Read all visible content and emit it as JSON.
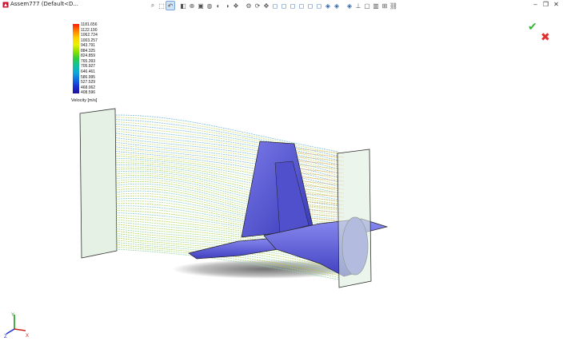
{
  "window": {
    "title": "Assem777  (Default<D..."
  },
  "toolbar": {
    "icons": [
      "zoom-fit-icon",
      "zoom-area-icon",
      "previous-view-icon",
      "section-view-icon",
      "dynamic-annotation-icon",
      "view-orientation-icon",
      "display-style-icon",
      "hide-show-icon",
      "appearance-icon",
      "scene-icon",
      "view-settings-icon",
      "rotate-icon",
      "pan-icon",
      "front-view-icon",
      "back-view-icon",
      "left-view-icon",
      "right-view-icon",
      "top-view-icon",
      "bottom-view-icon",
      "isometric-view-icon",
      "trimetric-view-icon",
      "dimetric-view-icon",
      "normal-to-icon",
      "single-view-icon",
      "two-view-icon",
      "four-view-icon",
      "link-views-icon"
    ]
  },
  "legend": {
    "ticks": [
      "1181.656",
      "1122.190",
      "1062.724",
      "1003.257",
      "943.791",
      "884.325",
      "824.859",
      "765.393",
      "705.927",
      "646.461",
      "586.995",
      "527.529",
      "468.062",
      "408.596"
    ],
    "label": "Velocity [m/s]",
    "color_max": "#ff1a00",
    "color_min": "#2010a0"
  },
  "confirm": {
    "symbol": "✔",
    "color": "#3cb43c"
  },
  "cancel": {
    "symbol": "✖",
    "color": "#e03030"
  },
  "triad": {
    "x": "X",
    "y": "Y",
    "z": "Z"
  },
  "model": {
    "fluid_color": "#5a5ad8",
    "streamline_count": 60
  }
}
